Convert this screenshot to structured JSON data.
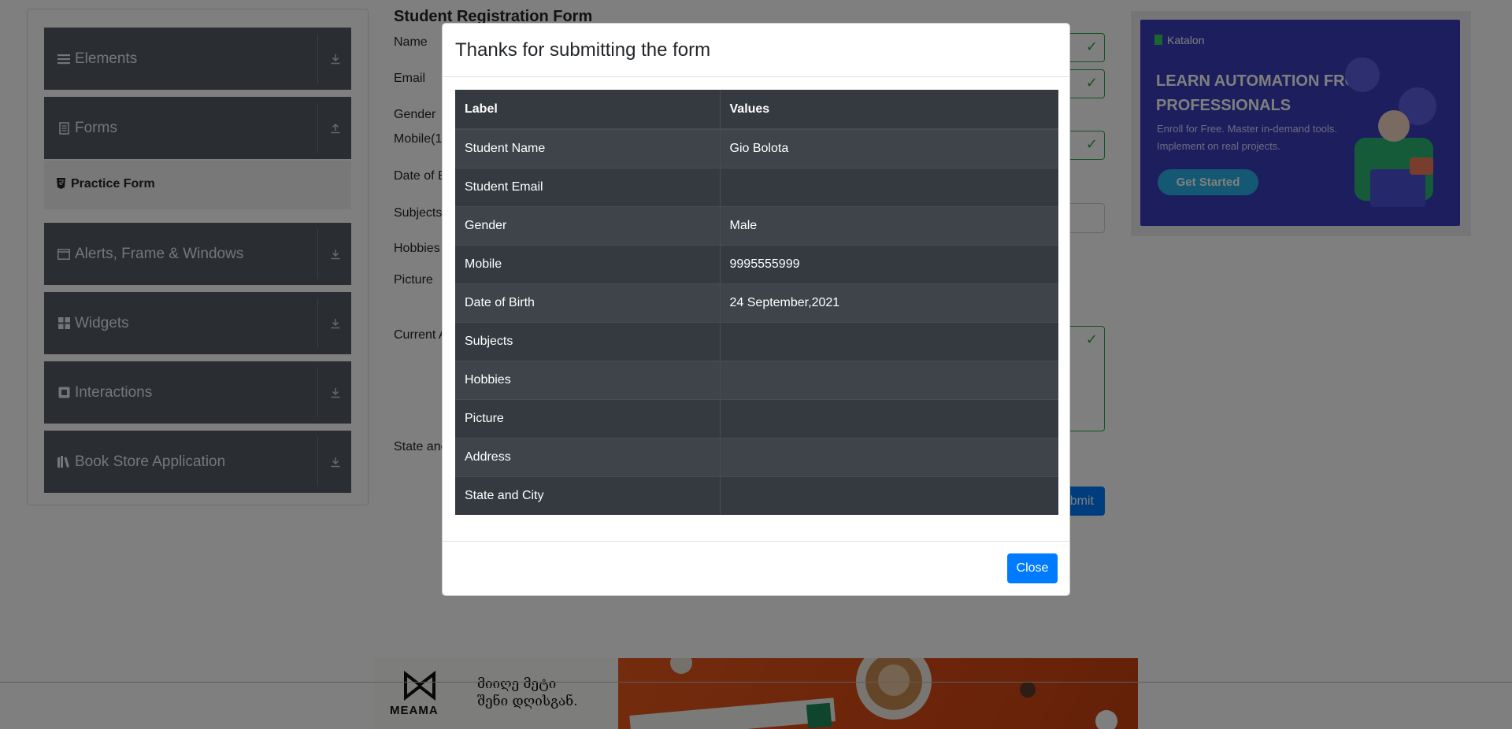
{
  "sidebar": {
    "groups": [
      {
        "label": "Elements",
        "icon": "list-icon"
      },
      {
        "label": "Forms",
        "icon": "form-icon"
      },
      {
        "label": "Alerts, Frame & Windows",
        "icon": "window-icon"
      },
      {
        "label": "Widgets",
        "icon": "widgets-icon"
      },
      {
        "label": "Interactions",
        "icon": "interactions-icon"
      },
      {
        "label": "Book Store Application",
        "icon": "books-icon"
      }
    ],
    "active_item": "Practice Form"
  },
  "form": {
    "title": "Student Registration Form",
    "labels": {
      "name": "Name",
      "email": "Email",
      "gender": "Gender",
      "mobile": "Mobile(1",
      "dob": "Date of B",
      "subjects": "Subjects",
      "hobbies": "Hobbies",
      "picture": "Picture",
      "address": "Current A",
      "state": "State and"
    },
    "submit_label": "Submit"
  },
  "ad_right": {
    "brand": "Katalon",
    "headline": "LEARN AUTOMATION FROM PROFESSIONALS",
    "sub": "Enroll for Free. Master in-demand tools. Implement on real projects.",
    "cta": "Get Started"
  },
  "ad_bottom": {
    "logo": "MEAMA",
    "slogan_line1": "მიიღე მეტი",
    "slogan_line2": "შენი დღისგან."
  },
  "modal": {
    "title": "Thanks for submitting the form",
    "columns": [
      "Label",
      "Values"
    ],
    "rows": [
      {
        "label": "Student Name",
        "value": "Gio Bolota"
      },
      {
        "label": "Student Email",
        "value": ""
      },
      {
        "label": "Gender",
        "value": "Male"
      },
      {
        "label": "Mobile",
        "value": "9995555999"
      },
      {
        "label": "Date of Birth",
        "value": "24 September,2021"
      },
      {
        "label": "Subjects",
        "value": ""
      },
      {
        "label": "Hobbies",
        "value": ""
      },
      {
        "label": "Picture",
        "value": ""
      },
      {
        "label": "Address",
        "value": ""
      },
      {
        "label": "State and City",
        "value": ""
      }
    ],
    "close_label": "Close"
  },
  "colors": {
    "sidebar_group": "#545b62",
    "primary": "#007bff",
    "valid": "#28a745",
    "table_dark": "#343a40",
    "overlay": "rgba(0,0,0,0.5)"
  }
}
